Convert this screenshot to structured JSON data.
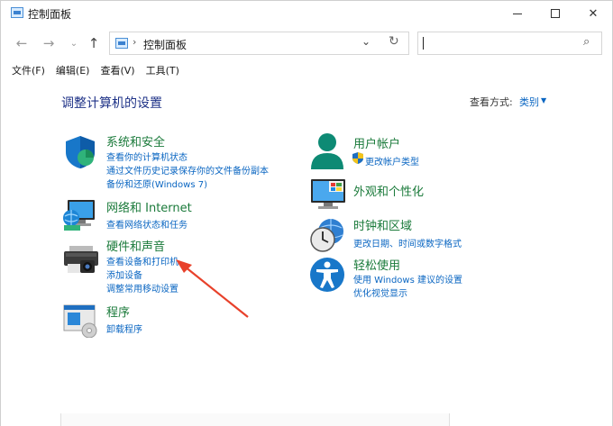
{
  "window": {
    "title": "控制面板"
  },
  "nav": {
    "address": "控制面板",
    "search_placeholder": ""
  },
  "menu": [
    "文件(F)",
    "编辑(E)",
    "查看(V)",
    "工具(T)"
  ],
  "header": {
    "title": "调整计算机的设置",
    "view_by_label": "查看方式:",
    "view_by_value": "类别"
  },
  "categories_left": [
    {
      "title": "系统和安全",
      "links": [
        "查看你的计算机状态",
        "通过文件历史记录保存你的文件备份副本",
        "备份和还原(Windows 7)"
      ]
    },
    {
      "title": "网络和 Internet",
      "links": [
        "查看网络状态和任务"
      ]
    },
    {
      "title": "硬件和声音",
      "links": [
        "查看设备和打印机",
        "添加设备",
        "调整常用移动设置"
      ]
    },
    {
      "title": "程序",
      "links": [
        "卸载程序"
      ]
    }
  ],
  "categories_right": [
    {
      "title": "用户帐户",
      "links": [
        "更改帐户类型"
      ]
    },
    {
      "title": "外观和个性化",
      "links": []
    },
    {
      "title": "时钟和区域",
      "links": [
        "更改日期、时间或数字格式"
      ]
    },
    {
      "title": "轻松使用",
      "links": [
        "使用 Windows 建议的设置",
        "优化视觉显示"
      ]
    }
  ],
  "colors": {
    "category_title": "#1a7a3a",
    "link": "#0a66c2",
    "page_title": "#1e3287",
    "annotation_arrow": "#e8412b"
  }
}
